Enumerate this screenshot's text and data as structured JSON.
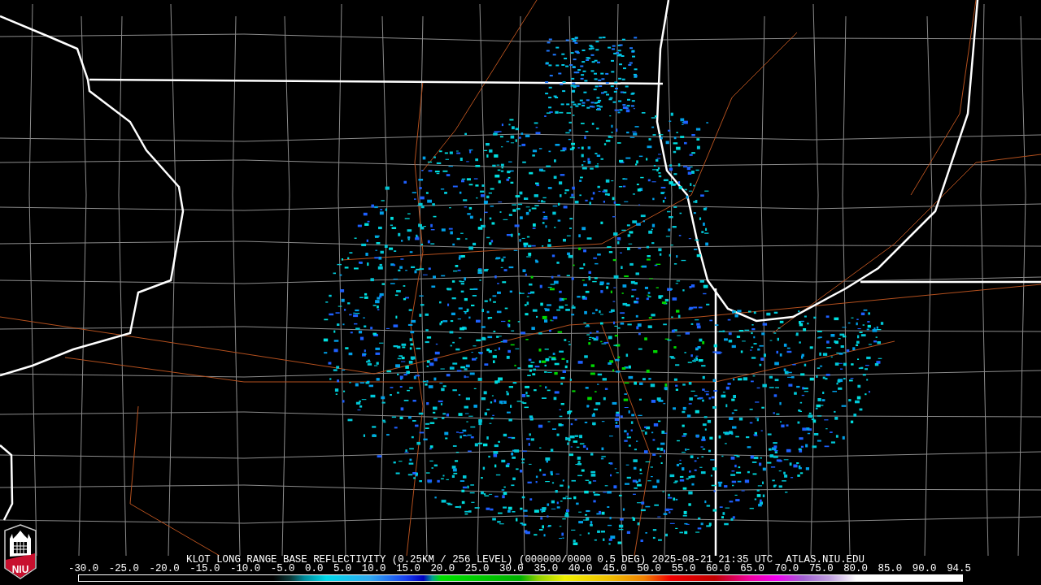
{
  "logo": {
    "text": "NIU"
  },
  "title": "KLOT LONG RANGE BASE REFLECTIVITY (0.25KM / 256 LEVEL) (000000/0000 0.5 DEG) 2025-08-21 21:35 UTC",
  "source": "ATLAS.NIU.EDU",
  "scale_labels": [
    "-30.0",
    "-25.0",
    "-20.0",
    "-15.0",
    "-10.0",
    "-5.0",
    "0.0",
    "5.0",
    "10.0",
    "15.0",
    "20.0",
    "25.0",
    "30.0",
    "35.0",
    "40.0",
    "45.0",
    "50.0",
    "55.0",
    "60.0",
    "65.0",
    "70.0",
    "75.0",
    "80.0",
    "85.0",
    "90.0",
    "94.5"
  ]
}
